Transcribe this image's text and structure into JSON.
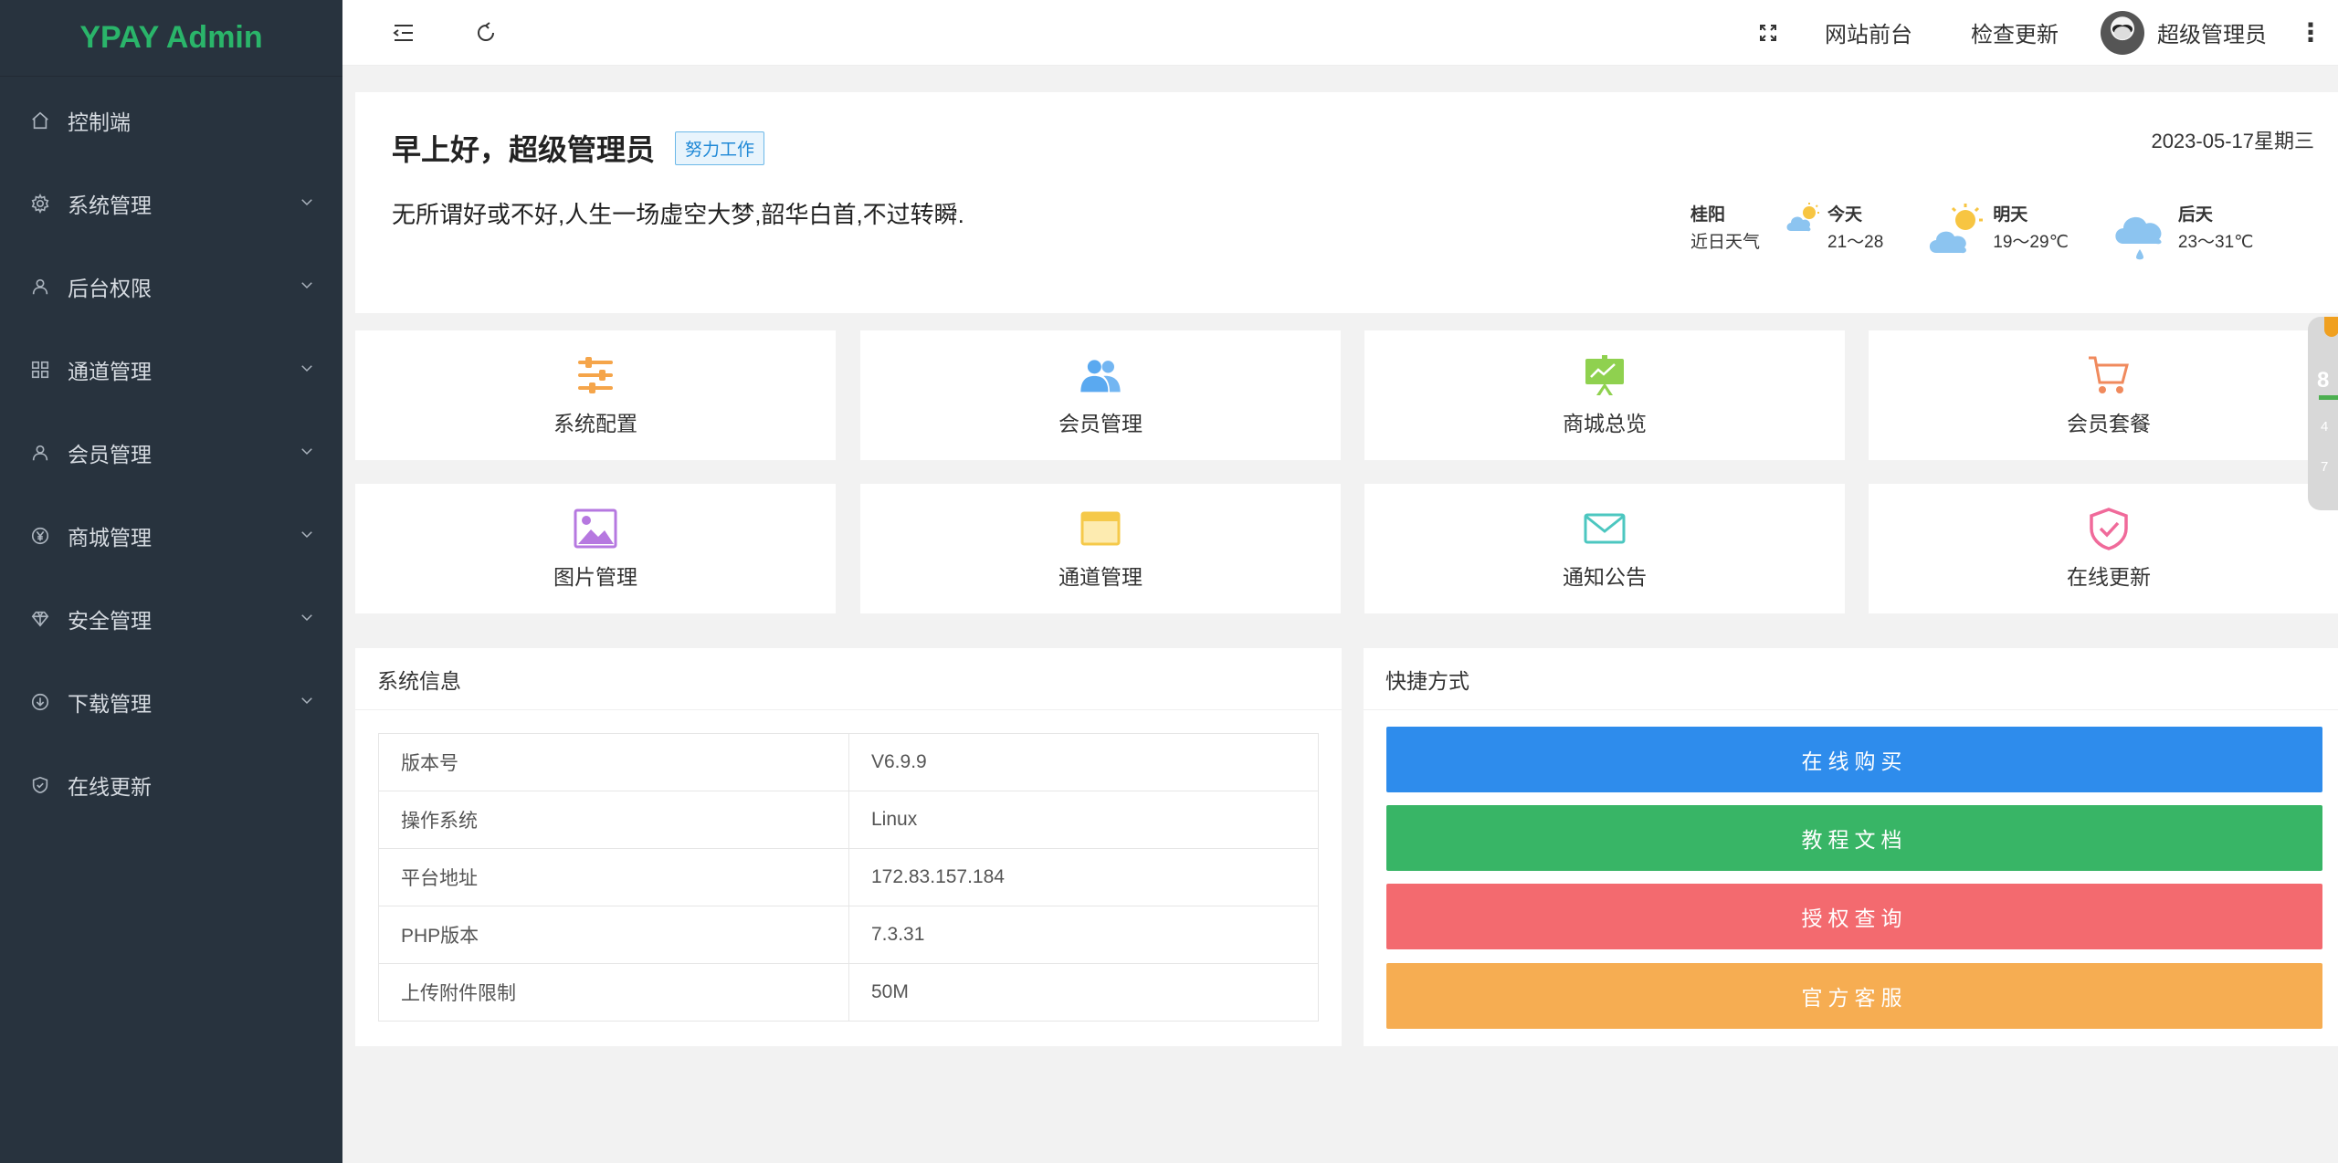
{
  "app": {
    "title": "YPAY Admin"
  },
  "sidebar": {
    "items": [
      {
        "label": "控制端",
        "icon": "home-icon",
        "expandable": false
      },
      {
        "label": "系统管理",
        "icon": "gear-icon",
        "expandable": true
      },
      {
        "label": "后台权限",
        "icon": "user-icon",
        "expandable": true
      },
      {
        "label": "通道管理",
        "icon": "apps-icon",
        "expandable": true
      },
      {
        "label": "会员管理",
        "icon": "user-icon",
        "expandable": true
      },
      {
        "label": "商城管理",
        "icon": "yen-icon",
        "expandable": true
      },
      {
        "label": "安全管理",
        "icon": "diamond-icon",
        "expandable": true
      },
      {
        "label": "下载管理",
        "icon": "download-icon",
        "expandable": true
      },
      {
        "label": "在线更新",
        "icon": "shield-icon",
        "expandable": false
      }
    ]
  },
  "header": {
    "site_front": "网站前台",
    "check_update": "检查更新",
    "user_name": "超级管理员"
  },
  "welcome": {
    "greeting": "早上好，超级管理员",
    "tag": "努力工作",
    "quote": "无所谓好或不好,人生一场虚空大梦,韶华白首,不过转瞬.",
    "date": "2023-05-17星期三",
    "weather": {
      "city": "桂阳",
      "caption": "近日天气",
      "days": [
        {
          "name": "今天",
          "range": "21～28"
        },
        {
          "name": "明天",
          "range": "19～29℃"
        },
        {
          "name": "后天",
          "range": "23～31℃"
        }
      ]
    }
  },
  "tiles": [
    {
      "label": "系统配置",
      "icon": "sliders-icon",
      "color": "#f5a54a"
    },
    {
      "label": "会员管理",
      "icon": "users-icon",
      "color": "#5aa9f0"
    },
    {
      "label": "商城总览",
      "icon": "presentation-icon",
      "color": "#8fd14f"
    },
    {
      "label": "会员套餐",
      "icon": "cart-icon",
      "color": "#f08a5d"
    },
    {
      "label": "图片管理",
      "icon": "image-icon",
      "color": "#b678e0"
    },
    {
      "label": "通道管理",
      "icon": "window-icon",
      "color": "#f5c94a"
    },
    {
      "label": "通知公告",
      "icon": "mail-icon",
      "color": "#4cc7c0"
    },
    {
      "label": "在线更新",
      "icon": "shield-check-icon",
      "color": "#f06a9a"
    }
  ],
  "sysinfo": {
    "title": "系统信息",
    "rows": [
      {
        "key": "版本号",
        "value": "V6.9.9"
      },
      {
        "key": "操作系统",
        "value": "Linux"
      },
      {
        "key": "平台地址",
        "value": "172.83.157.184"
      },
      {
        "key": "PHP版本",
        "value": "7.3.31"
      },
      {
        "key": "上传附件限制",
        "value": "50M"
      }
    ]
  },
  "shortcuts": {
    "title": "快捷方式",
    "buttons": [
      {
        "label": "在线购买",
        "color": "#2e8cec"
      },
      {
        "label": "教程文档",
        "color": "#38b566"
      },
      {
        "label": "授权查询",
        "color": "#f36a6f"
      },
      {
        "label": "官方客服",
        "color": "#f6ad52"
      }
    ]
  },
  "float_widget": {
    "value": "8",
    "line1": "4",
    "line2": "7"
  }
}
